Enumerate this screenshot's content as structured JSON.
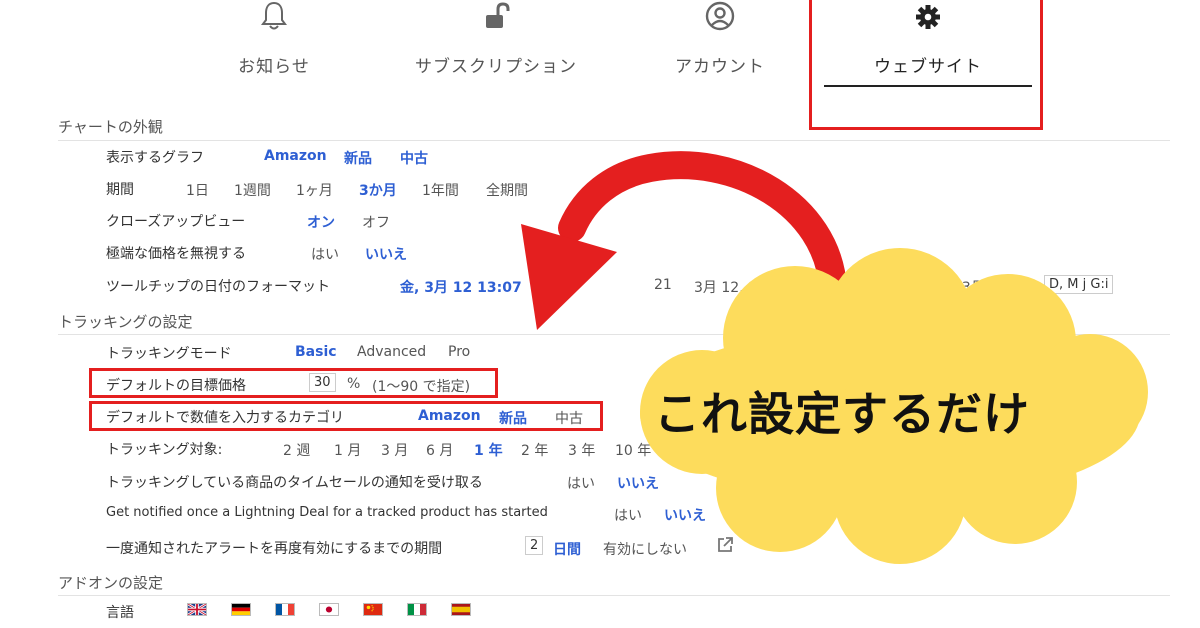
{
  "tabs": [
    {
      "label": "お知らせ",
      "icon": "bell-icon"
    },
    {
      "label": "サブスクリプション",
      "icon": "unlock-icon"
    },
    {
      "label": "アカウント",
      "icon": "account-icon"
    },
    {
      "label": "ウェブサイト",
      "icon": "gear-icon"
    }
  ],
  "sections": {
    "chart": "チャートの外観",
    "tracking": "トラッキングの設定",
    "addon": "アドオンの設定"
  },
  "chart_rows": {
    "graph": {
      "label": "表示するグラフ",
      "options": [
        "Amazon",
        "新品",
        "中古"
      ]
    },
    "period": {
      "label": "期間",
      "options": [
        "1日",
        "1週間",
        "1ヶ月",
        "3か月",
        "1年間",
        "全期間"
      ]
    },
    "closeup": {
      "label": "クローズアップビュー",
      "options": [
        "オン",
        "オフ"
      ]
    },
    "extreme": {
      "label": "極端な価格を無視する",
      "options": [
        "はい",
        "いいえ"
      ]
    },
    "tooltip": {
      "label": "ツールチップの日付のフォーマット",
      "options": [
        "金, 3月 12 13:07",
        "21",
        "3月 12, 1",
        "13時3月12日"
      ],
      "custom": "D, M j G:i"
    }
  },
  "tracking_rows": {
    "mode": {
      "label": "トラッキングモード",
      "options": [
        "Basic",
        "Advanced",
        "Pro"
      ]
    },
    "target": {
      "label": "デフォルトの目標価格",
      "value": "30",
      "unit": "%",
      "hint": "(1〜90 で指定)"
    },
    "category": {
      "label": "デフォルトで数値を入力するカテゴリ",
      "options": [
        "Amazon",
        "新品",
        "中古"
      ]
    },
    "duration": {
      "label": "トラッキング対象:",
      "options": [
        "2 週",
        "1 月",
        "3 月",
        "6 月",
        "1 年",
        "2 年",
        "3 年",
        "10 年"
      ]
    },
    "lightning_jp": {
      "label": "トラッキングしている商品のタイムセールの通知を受け取る",
      "options": [
        "はい",
        "いいえ"
      ]
    },
    "lightning_en": {
      "label": "Get notified once a Lightning Deal for a tracked product has started",
      "options": [
        "はい",
        "いいえ"
      ]
    },
    "reenable": {
      "label": "一度通知されたアラートを再度有効にするまでの期間",
      "value": "2",
      "unit": "日間",
      "disable": "有効にしない"
    }
  },
  "addon_rows": {
    "language": {
      "label": "言語"
    }
  },
  "callout": "これ設定するだけ",
  "colors": {
    "accent": "#2e5fd3",
    "annotation_red": "#e41f1f",
    "cloud": "#fddc5c"
  }
}
